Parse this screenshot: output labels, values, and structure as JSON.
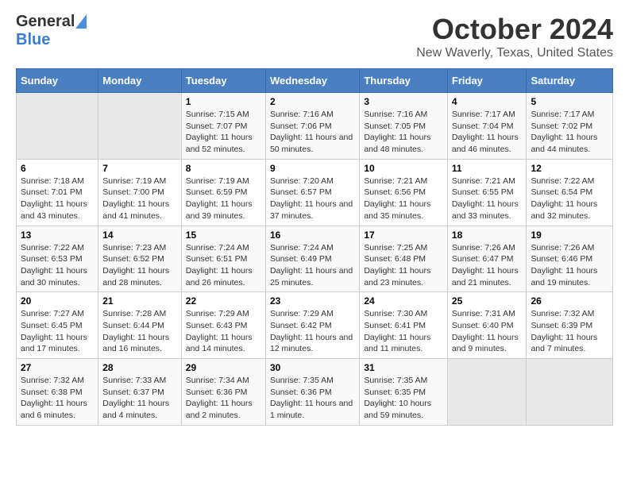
{
  "logo": {
    "general": "General",
    "blue": "Blue"
  },
  "title": "October 2024",
  "subtitle": "New Waverly, Texas, United States",
  "header_days": [
    "Sunday",
    "Monday",
    "Tuesday",
    "Wednesday",
    "Thursday",
    "Friday",
    "Saturday"
  ],
  "weeks": [
    [
      {
        "day": "",
        "sunrise": "",
        "sunset": "",
        "daylight": ""
      },
      {
        "day": "",
        "sunrise": "",
        "sunset": "",
        "daylight": ""
      },
      {
        "day": "1",
        "sunrise": "Sunrise: 7:15 AM",
        "sunset": "Sunset: 7:07 PM",
        "daylight": "Daylight: 11 hours and 52 minutes."
      },
      {
        "day": "2",
        "sunrise": "Sunrise: 7:16 AM",
        "sunset": "Sunset: 7:06 PM",
        "daylight": "Daylight: 11 hours and 50 minutes."
      },
      {
        "day": "3",
        "sunrise": "Sunrise: 7:16 AM",
        "sunset": "Sunset: 7:05 PM",
        "daylight": "Daylight: 11 hours and 48 minutes."
      },
      {
        "day": "4",
        "sunrise": "Sunrise: 7:17 AM",
        "sunset": "Sunset: 7:04 PM",
        "daylight": "Daylight: 11 hours and 46 minutes."
      },
      {
        "day": "5",
        "sunrise": "Sunrise: 7:17 AM",
        "sunset": "Sunset: 7:02 PM",
        "daylight": "Daylight: 11 hours and 44 minutes."
      }
    ],
    [
      {
        "day": "6",
        "sunrise": "Sunrise: 7:18 AM",
        "sunset": "Sunset: 7:01 PM",
        "daylight": "Daylight: 11 hours and 43 minutes."
      },
      {
        "day": "7",
        "sunrise": "Sunrise: 7:19 AM",
        "sunset": "Sunset: 7:00 PM",
        "daylight": "Daylight: 11 hours and 41 minutes."
      },
      {
        "day": "8",
        "sunrise": "Sunrise: 7:19 AM",
        "sunset": "Sunset: 6:59 PM",
        "daylight": "Daylight: 11 hours and 39 minutes."
      },
      {
        "day": "9",
        "sunrise": "Sunrise: 7:20 AM",
        "sunset": "Sunset: 6:57 PM",
        "daylight": "Daylight: 11 hours and 37 minutes."
      },
      {
        "day": "10",
        "sunrise": "Sunrise: 7:21 AM",
        "sunset": "Sunset: 6:56 PM",
        "daylight": "Daylight: 11 hours and 35 minutes."
      },
      {
        "day": "11",
        "sunrise": "Sunrise: 7:21 AM",
        "sunset": "Sunset: 6:55 PM",
        "daylight": "Daylight: 11 hours and 33 minutes."
      },
      {
        "day": "12",
        "sunrise": "Sunrise: 7:22 AM",
        "sunset": "Sunset: 6:54 PM",
        "daylight": "Daylight: 11 hours and 32 minutes."
      }
    ],
    [
      {
        "day": "13",
        "sunrise": "Sunrise: 7:22 AM",
        "sunset": "Sunset: 6:53 PM",
        "daylight": "Daylight: 11 hours and 30 minutes."
      },
      {
        "day": "14",
        "sunrise": "Sunrise: 7:23 AM",
        "sunset": "Sunset: 6:52 PM",
        "daylight": "Daylight: 11 hours and 28 minutes."
      },
      {
        "day": "15",
        "sunrise": "Sunrise: 7:24 AM",
        "sunset": "Sunset: 6:51 PM",
        "daylight": "Daylight: 11 hours and 26 minutes."
      },
      {
        "day": "16",
        "sunrise": "Sunrise: 7:24 AM",
        "sunset": "Sunset: 6:49 PM",
        "daylight": "Daylight: 11 hours and 25 minutes."
      },
      {
        "day": "17",
        "sunrise": "Sunrise: 7:25 AM",
        "sunset": "Sunset: 6:48 PM",
        "daylight": "Daylight: 11 hours and 23 minutes."
      },
      {
        "day": "18",
        "sunrise": "Sunrise: 7:26 AM",
        "sunset": "Sunset: 6:47 PM",
        "daylight": "Daylight: 11 hours and 21 minutes."
      },
      {
        "day": "19",
        "sunrise": "Sunrise: 7:26 AM",
        "sunset": "Sunset: 6:46 PM",
        "daylight": "Daylight: 11 hours and 19 minutes."
      }
    ],
    [
      {
        "day": "20",
        "sunrise": "Sunrise: 7:27 AM",
        "sunset": "Sunset: 6:45 PM",
        "daylight": "Daylight: 11 hours and 17 minutes."
      },
      {
        "day": "21",
        "sunrise": "Sunrise: 7:28 AM",
        "sunset": "Sunset: 6:44 PM",
        "daylight": "Daylight: 11 hours and 16 minutes."
      },
      {
        "day": "22",
        "sunrise": "Sunrise: 7:29 AM",
        "sunset": "Sunset: 6:43 PM",
        "daylight": "Daylight: 11 hours and 14 minutes."
      },
      {
        "day": "23",
        "sunrise": "Sunrise: 7:29 AM",
        "sunset": "Sunset: 6:42 PM",
        "daylight": "Daylight: 11 hours and 12 minutes."
      },
      {
        "day": "24",
        "sunrise": "Sunrise: 7:30 AM",
        "sunset": "Sunset: 6:41 PM",
        "daylight": "Daylight: 11 hours and 11 minutes."
      },
      {
        "day": "25",
        "sunrise": "Sunrise: 7:31 AM",
        "sunset": "Sunset: 6:40 PM",
        "daylight": "Daylight: 11 hours and 9 minutes."
      },
      {
        "day": "26",
        "sunrise": "Sunrise: 7:32 AM",
        "sunset": "Sunset: 6:39 PM",
        "daylight": "Daylight: 11 hours and 7 minutes."
      }
    ],
    [
      {
        "day": "27",
        "sunrise": "Sunrise: 7:32 AM",
        "sunset": "Sunset: 6:38 PM",
        "daylight": "Daylight: 11 hours and 6 minutes."
      },
      {
        "day": "28",
        "sunrise": "Sunrise: 7:33 AM",
        "sunset": "Sunset: 6:37 PM",
        "daylight": "Daylight: 11 hours and 4 minutes."
      },
      {
        "day": "29",
        "sunrise": "Sunrise: 7:34 AM",
        "sunset": "Sunset: 6:36 PM",
        "daylight": "Daylight: 11 hours and 2 minutes."
      },
      {
        "day": "30",
        "sunrise": "Sunrise: 7:35 AM",
        "sunset": "Sunset: 6:36 PM",
        "daylight": "Daylight: 11 hours and 1 minute."
      },
      {
        "day": "31",
        "sunrise": "Sunrise: 7:35 AM",
        "sunset": "Sunset: 6:35 PM",
        "daylight": "Daylight: 10 hours and 59 minutes."
      },
      {
        "day": "",
        "sunrise": "",
        "sunset": "",
        "daylight": ""
      },
      {
        "day": "",
        "sunrise": "",
        "sunset": "",
        "daylight": ""
      }
    ]
  ]
}
